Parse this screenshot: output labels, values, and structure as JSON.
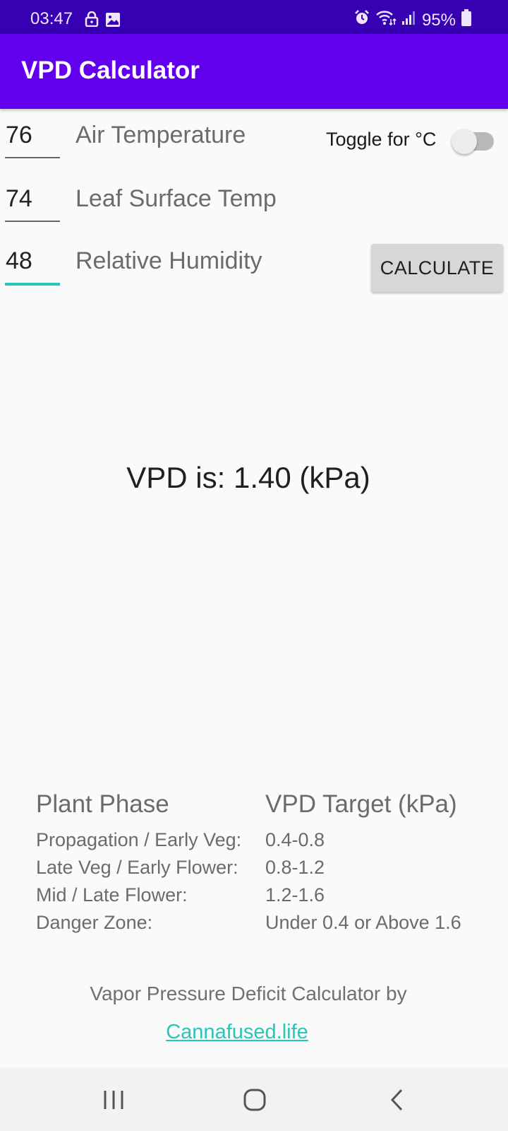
{
  "status_bar": {
    "time": "03:47",
    "battery": "95%",
    "icons": [
      "lock-icon",
      "image-icon",
      "alarm-icon",
      "wifi-icon",
      "signal-icon",
      "battery-icon"
    ]
  },
  "app_bar": {
    "title": "VPD Calculator"
  },
  "inputs": {
    "air_temperature": {
      "value": "76",
      "label": "Air Temperature"
    },
    "leaf_surface_temp": {
      "value": "74",
      "label": "Leaf Surface Temp"
    },
    "relative_humidity": {
      "value": "48",
      "label": "Relative Humidity"
    }
  },
  "toggle": {
    "label": "Toggle for °C",
    "checked": false
  },
  "calculate_button": {
    "label": "CALCULATE"
  },
  "result": {
    "text": "VPD is: 1.40 (kPa)"
  },
  "table": {
    "headers": [
      "Plant Phase",
      "VPD Target (kPa)"
    ],
    "rows": [
      {
        "phase": "Propagation / Early Veg:",
        "target": "0.4-0.8"
      },
      {
        "phase": "Late Veg / Early Flower:",
        "target": "0.8-1.2"
      },
      {
        "phase": "Mid / Late Flower:",
        "target": "1.2-1.6"
      },
      {
        "phase": "Danger Zone:",
        "target": "Under 0.4 or Above 1.6"
      }
    ]
  },
  "footer": {
    "text": "Vapor Pressure Deficit Calculator by",
    "link": "Cannafused.life"
  },
  "colors": {
    "status_bar": "#3700b3",
    "app_bar": "#6200ee",
    "accent": "#26c6b8"
  }
}
